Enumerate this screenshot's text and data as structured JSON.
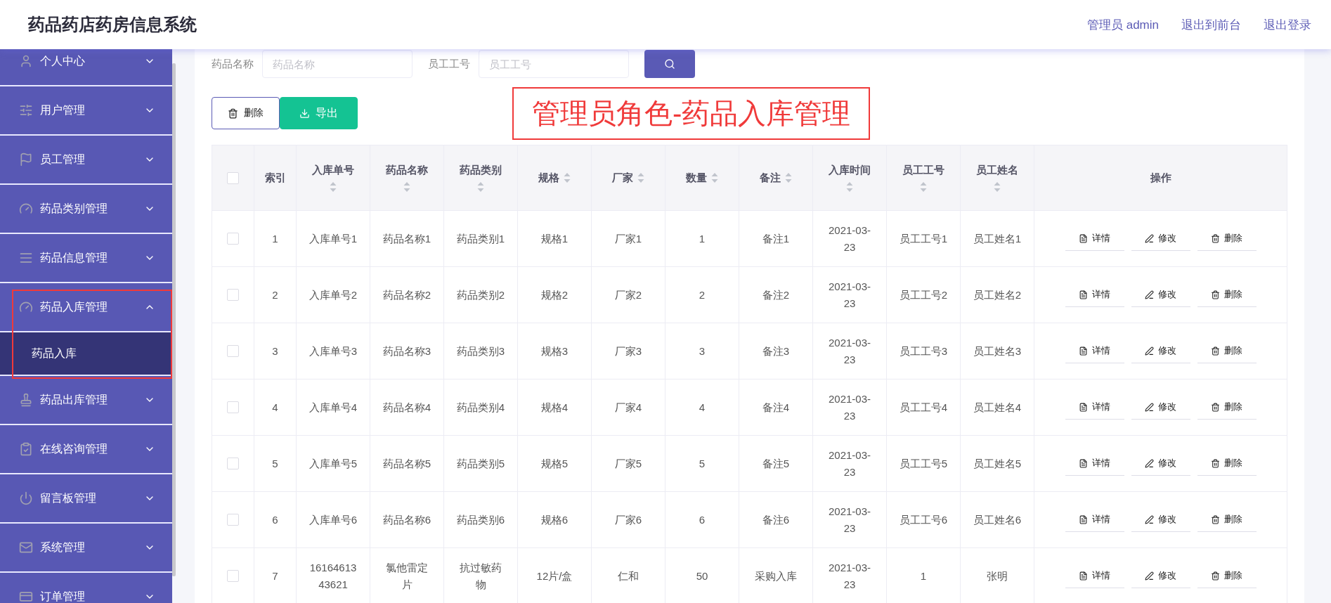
{
  "header": {
    "title": "药品药店药房信息系统",
    "links": [
      "管理员 admin",
      "退出到前台",
      "退出登录"
    ]
  },
  "sidebar": {
    "items": [
      {
        "kind": "user",
        "label": "个人中心",
        "expanded": false,
        "highlighted": false
      },
      {
        "kind": "sliders",
        "label": "用户管理",
        "expanded": false,
        "highlighted": false
      },
      {
        "kind": "flag",
        "label": "员工管理",
        "expanded": false,
        "highlighted": false
      },
      {
        "kind": "gauge",
        "label": "药品类别管理",
        "expanded": false,
        "highlighted": false
      },
      {
        "kind": "list",
        "label": "药品信息管理",
        "expanded": false,
        "highlighted": false
      },
      {
        "kind": "gauge",
        "label": "药品入库管理",
        "expanded": true,
        "highlighted": true,
        "children": [
          {
            "label": "药品入库",
            "selected": true
          }
        ]
      },
      {
        "kind": "stamp",
        "label": "药品出库管理",
        "expanded": false,
        "highlighted": false
      },
      {
        "kind": "clipboard",
        "label": "在线咨询管理",
        "expanded": false,
        "highlighted": false
      },
      {
        "kind": "power",
        "label": "留言板管理",
        "expanded": false,
        "highlighted": false
      },
      {
        "kind": "mail",
        "label": "系统管理",
        "expanded": false,
        "highlighted": false
      },
      {
        "kind": "card",
        "label": "订单管理",
        "expanded": false,
        "highlighted": false
      }
    ]
  },
  "search": {
    "fields": [
      {
        "label": "药品名称",
        "placeholder": "药品名称"
      },
      {
        "label": "员工工号",
        "placeholder": "员工工号"
      }
    ]
  },
  "toolbar": [
    {
      "kind": "delete",
      "label": "删除"
    },
    {
      "kind": "export",
      "label": "导出"
    }
  ],
  "caption": "管理员角色-药品入库管理",
  "table": {
    "all_checked": false,
    "columns": [
      {
        "label": "索引",
        "sortable": false
      },
      {
        "label": "入库单号",
        "sortable": true
      },
      {
        "label": "药品名称",
        "sortable": true
      },
      {
        "label": "药品类别",
        "sortable": true
      },
      {
        "label": "规格",
        "sortable": true
      },
      {
        "label": "厂家",
        "sortable": true
      },
      {
        "label": "数量",
        "sortable": true
      },
      {
        "label": "备注",
        "sortable": true
      },
      {
        "label": "入库时间",
        "sortable": true
      },
      {
        "label": "员工工号",
        "sortable": true
      },
      {
        "label": "员工姓名",
        "sortable": true
      },
      {
        "label": "操作",
        "sortable": false
      }
    ],
    "rows": [
      {
        "checked": false,
        "cells": [
          "1",
          "入库单号1",
          "药品名称1",
          "药品类别1",
          "规格1",
          "厂家1",
          "1",
          "备注1",
          "2021-03-23",
          "员工工号1",
          "员工姓名1"
        ],
        "actions": [
          {
            "kind": "detail",
            "label": "详情"
          },
          {
            "kind": "edit",
            "label": "修改"
          },
          {
            "kind": "delete",
            "label": "删除"
          }
        ]
      },
      {
        "checked": false,
        "cells": [
          "2",
          "入库单号2",
          "药品名称2",
          "药品类别2",
          "规格2",
          "厂家2",
          "2",
          "备注2",
          "2021-03-23",
          "员工工号2",
          "员工姓名2"
        ],
        "actions": [
          {
            "kind": "detail",
            "label": "详情"
          },
          {
            "kind": "edit",
            "label": "修改"
          },
          {
            "kind": "delete",
            "label": "删除"
          }
        ]
      },
      {
        "checked": false,
        "cells": [
          "3",
          "入库单号3",
          "药品名称3",
          "药品类别3",
          "规格3",
          "厂家3",
          "3",
          "备注3",
          "2021-03-23",
          "员工工号3",
          "员工姓名3"
        ],
        "actions": [
          {
            "kind": "detail",
            "label": "详情"
          },
          {
            "kind": "edit",
            "label": "修改"
          },
          {
            "kind": "delete",
            "label": "删除"
          }
        ]
      },
      {
        "checked": false,
        "cells": [
          "4",
          "入库单号4",
          "药品名称4",
          "药品类别4",
          "规格4",
          "厂家4",
          "4",
          "备注4",
          "2021-03-23",
          "员工工号4",
          "员工姓名4"
        ],
        "actions": [
          {
            "kind": "detail",
            "label": "详情"
          },
          {
            "kind": "edit",
            "label": "修改"
          },
          {
            "kind": "delete",
            "label": "删除"
          }
        ]
      },
      {
        "checked": false,
        "cells": [
          "5",
          "入库单号5",
          "药品名称5",
          "药品类别5",
          "规格5",
          "厂家5",
          "5",
          "备注5",
          "2021-03-23",
          "员工工号5",
          "员工姓名5"
        ],
        "actions": [
          {
            "kind": "detail",
            "label": "详情"
          },
          {
            "kind": "edit",
            "label": "修改"
          },
          {
            "kind": "delete",
            "label": "删除"
          }
        ]
      },
      {
        "checked": false,
        "cells": [
          "6",
          "入库单号6",
          "药品名称6",
          "药品类别6",
          "规格6",
          "厂家6",
          "6",
          "备注6",
          "2021-03-23",
          "员工工号6",
          "员工姓名6"
        ],
        "actions": [
          {
            "kind": "detail",
            "label": "详情"
          },
          {
            "kind": "edit",
            "label": "修改"
          },
          {
            "kind": "delete",
            "label": "删除"
          }
        ]
      },
      {
        "checked": false,
        "cells": [
          "7",
          "1616461343621",
          "氯他雷定片",
          "抗过敏药物",
          "12片/盒",
          "仁和",
          "50",
          "采购入库",
          "2021-03-23",
          "1",
          "张明"
        ],
        "actions": [
          {
            "kind": "detail",
            "label": "详情"
          },
          {
            "kind": "edit",
            "label": "修改"
          },
          {
            "kind": "delete",
            "label": "删除"
          }
        ]
      }
    ]
  }
}
